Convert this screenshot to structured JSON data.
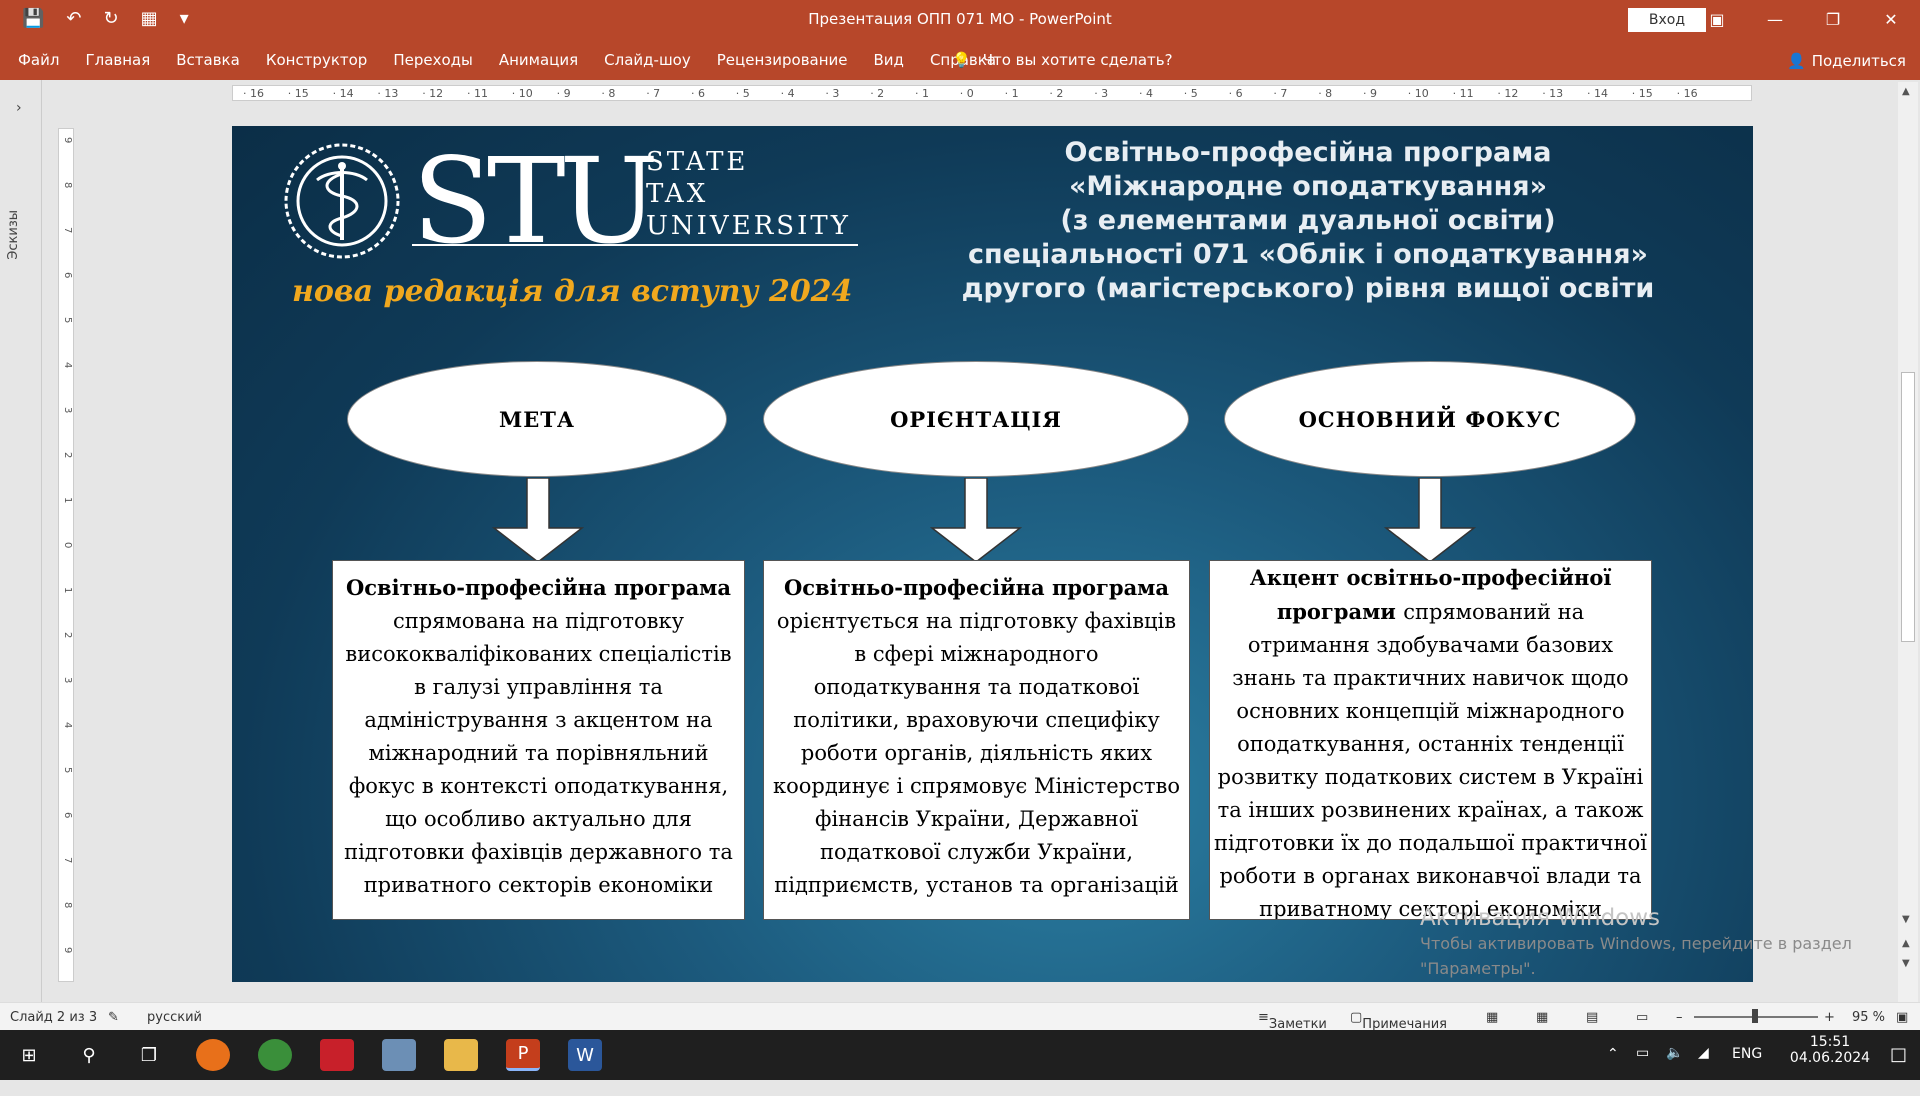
{
  "window": {
    "title": "Презентация ОПП 071 МО  -  PowerPoint",
    "login_label": "Вход"
  },
  "ribbon": {
    "tabs": [
      "Файл",
      "Главная",
      "Вставка",
      "Конструктор",
      "Переходы",
      "Анимация",
      "Слайд-шоу",
      "Рецензирование",
      "Вид",
      "Справка"
    ],
    "search_placeholder": "Что вы хотите сделать?",
    "share_label": "Поделиться"
  },
  "thumbs": {
    "label": "Эскизы"
  },
  "ruler": {
    "h_ticks": [
      "16",
      "15",
      "14",
      "13",
      "12",
      "11",
      "10",
      "9",
      "8",
      "7",
      "6",
      "5",
      "4",
      "3",
      "2",
      "1",
      "0",
      "1",
      "2",
      "3",
      "4",
      "5",
      "6",
      "7",
      "8",
      "9",
      "10",
      "11",
      "12",
      "13",
      "14",
      "15",
      "16"
    ],
    "v_ticks": [
      "9",
      "8",
      "7",
      "6",
      "5",
      "4",
      "3",
      "2",
      "1",
      "0",
      "1",
      "2",
      "3",
      "4",
      "5",
      "6",
      "7",
      "8",
      "9"
    ]
  },
  "slide": {
    "logo": {
      "main": "STU",
      "line1": "STATE",
      "line2": "TAX",
      "line3": "UNIVERSITY"
    },
    "tagline": "нова редакція для вступу 2024",
    "heading": [
      "Освітньо-професійна програма",
      "«Міжнародне оподаткування»",
      "(з елементами дуальної освіти)",
      "спеціальності 071 «Облік і оподаткування»",
      "другого (магістерського) рівня вищої освіти"
    ],
    "columns": [
      {
        "label": "МЕТА",
        "bold": "Освітньо-професійна програма",
        "text": "спрямована на підготовку висококваліфікованих спеціалістів в галузі управління та адміністрування з акцентом на міжнародний та порівняльний фокус в контексті оподаткування, що особливо актуально для підготовки фахівців державного та приватного секторів економіки"
      },
      {
        "label": "ОРІЄНТАЦІЯ",
        "bold": "Освітньо-професійна програма",
        "text": "орієнтується на підготовку фахівців в сфері міжнародного оподаткування та податкової політики, враховуючи специфіку роботи органів, діяльність яких координує і спрямовує Міністерство фінансів України, Державної податкової служби України, підприємств, установ та організацій"
      },
      {
        "label": "ОСНОВНИЙ ФОКУС",
        "bold": "Акцент освітньо-професійної програми",
        "text": "спрямований на отримання здобувачами базових знань та практичних навичок щодо основних концепцій міжнародного оподаткування, останніх тенденції розвитку податкових систем в Україні та інших розвинених країнах, а також підготовки їх до подальшої практичної роботи в органах виконавчої влади та приватному секторі економіки"
      }
    ]
  },
  "watermark": {
    "title": "Активация Windows",
    "line1": "Чтобы активировать Windows, перейдите в раздел",
    "line2": "\"Параметры\"."
  },
  "status": {
    "slide": "Слайд 2 из 3",
    "lang": "русский",
    "notes": "Заметки",
    "comments": "Примечания",
    "zoom": "95 %"
  },
  "taskbar": {
    "lang": "ENG",
    "time": "15:51",
    "date": "04.06.2024"
  },
  "colors": {
    "accent": "#b7472a",
    "tagline": "#f0a81e",
    "slide_bg": "#0f3a57"
  }
}
